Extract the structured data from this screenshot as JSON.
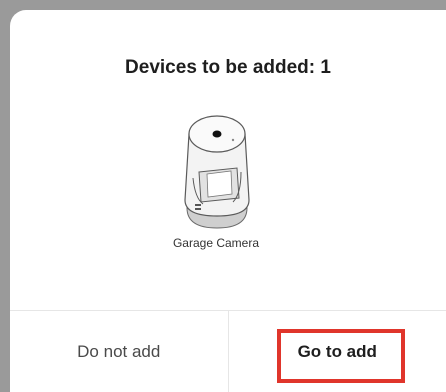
{
  "dialog": {
    "title": "Devices to be added: 1",
    "device": {
      "name": "Garage Camera",
      "icon": "camera-device-icon"
    },
    "buttons": {
      "cancel_label": "Do not add",
      "confirm_label": "Go to add"
    },
    "highlight_color": "#e0352b"
  }
}
